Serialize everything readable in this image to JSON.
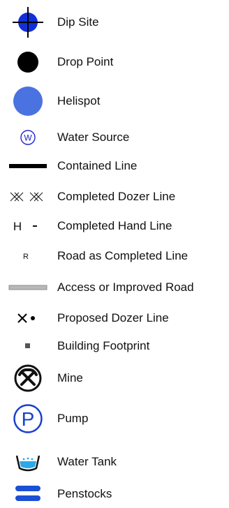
{
  "legend": {
    "items": [
      {
        "icon": "dip-site-icon",
        "label": "Dip Site",
        "color": "#1230d8"
      },
      {
        "icon": "drop-point-icon",
        "label": "Drop Point",
        "color": "#000000"
      },
      {
        "icon": "helispot-icon",
        "label": "Helispot",
        "color": "#4a72e0"
      },
      {
        "icon": "water-source-icon",
        "label": "Water Source",
        "symbol_text": "W",
        "color": "#2222cc"
      },
      {
        "icon": "contained-line-icon",
        "label": "Contained Line",
        "color": "#000000"
      },
      {
        "icon": "completed-dozer-line-icon",
        "label": "Completed Dozer Line",
        "color": "#111111"
      },
      {
        "icon": "completed-hand-line-icon",
        "label": "Completed Hand Line",
        "symbol_text": "H",
        "color": "#111111"
      },
      {
        "icon": "road-as-completed-line-icon",
        "label": "Road as Completed Line",
        "symbol_text": "R",
        "color": "#111111"
      },
      {
        "icon": "access-improved-road-icon",
        "label": "Access or Improved Road",
        "color": "#b8b8b8"
      },
      {
        "icon": "proposed-dozer-line-icon",
        "label": "Proposed Dozer Line",
        "color": "#000000"
      },
      {
        "icon": "building-footprint-icon",
        "label": "Building Footprint",
        "color": "#555555"
      },
      {
        "icon": "mine-icon",
        "label": "Mine",
        "color": "#111111"
      },
      {
        "icon": "pump-icon",
        "label": "Pump",
        "symbol_text": "P",
        "color": "#1a3fd0"
      },
      {
        "icon": "water-tank-icon",
        "label": "Water Tank",
        "color": "#2aa8e8"
      },
      {
        "icon": "penstocks-icon",
        "label": "Penstocks",
        "color": "#1a4fd6"
      }
    ]
  }
}
